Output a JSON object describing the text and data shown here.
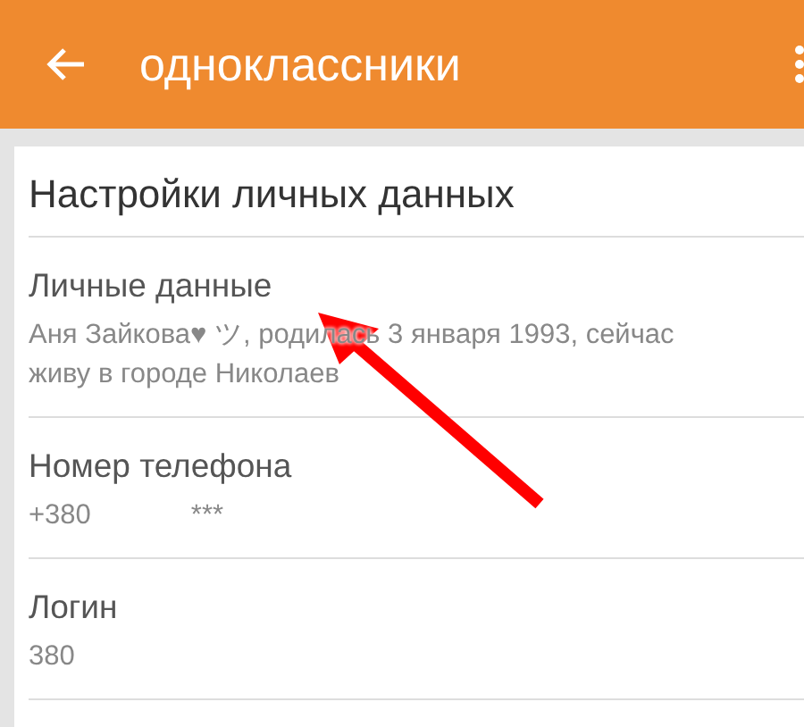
{
  "app_bar": {
    "title": "одноклассники"
  },
  "section_title": "Настройки личных данных",
  "items": [
    {
      "title": "Личные данные",
      "values": [
        "Аня Зайкова♥ ツ, родилась 3 января 1993, сейчас живу в городе Николаев"
      ]
    },
    {
      "title": "Номер телефона",
      "values": [
        "+380",
        "***"
      ]
    },
    {
      "title": "Логин",
      "values": [
        "380"
      ]
    }
  ]
}
